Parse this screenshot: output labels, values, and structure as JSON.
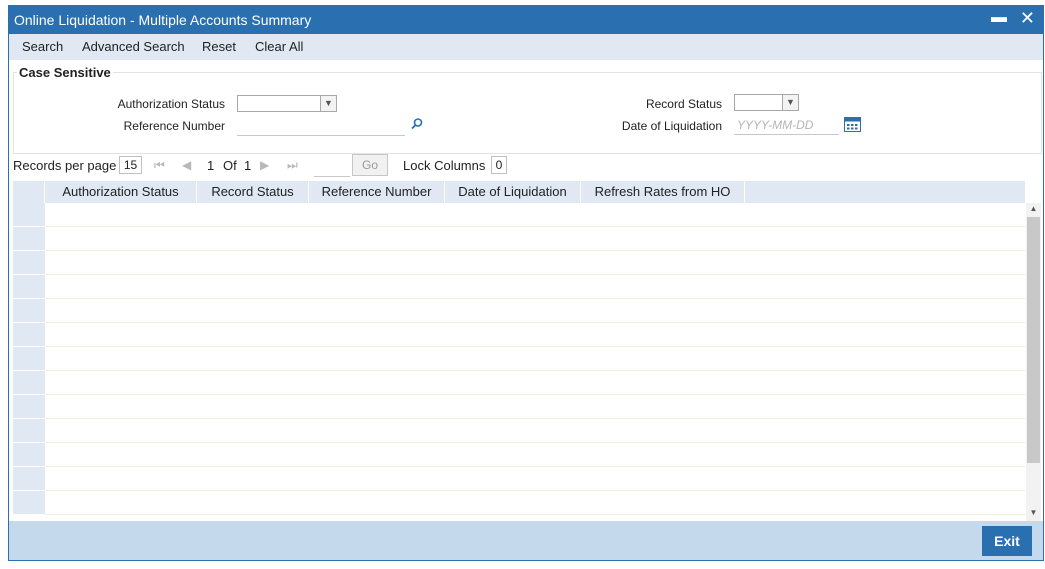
{
  "window": {
    "title": "Online Liquidation - Multiple Accounts Summary",
    "minimize_glyph": "▬",
    "close_glyph": "✕"
  },
  "menu": {
    "search": "Search",
    "advanced_search": "Advanced Search",
    "reset": "Reset",
    "clear_all": "Clear All"
  },
  "criteria": {
    "section_title": "Case Sensitive",
    "authorization_status_label": "Authorization Status",
    "authorization_status_value": "",
    "reference_number_label": "Reference Number",
    "reference_number_value": "",
    "record_status_label": "Record Status",
    "record_status_value": "",
    "date_label": "Date of Liquidation",
    "date_placeholder": "YYYY-MM-DD"
  },
  "pager": {
    "records_per_page_label": "Records per page",
    "records_per_page": "15",
    "current_page": "1",
    "of_label": "Of",
    "total_pages": "1",
    "go_label": "Go",
    "lock_columns_label": "Lock Columns",
    "lock_columns": "0"
  },
  "grid": {
    "columns": [
      "Authorization Status",
      "Record Status",
      "Reference Number",
      "Date of Liquidation",
      "Refresh Rates from HO"
    ],
    "row_count": 13
  },
  "footer": {
    "exit_label": "Exit"
  },
  "icons": {
    "search": "magnifier-icon",
    "calendar": "calendar-icon"
  },
  "colors": {
    "title_bar": "#2a6fb0",
    "header_bg": "#dfe8f3",
    "footer_bg": "#c4d9ec"
  }
}
